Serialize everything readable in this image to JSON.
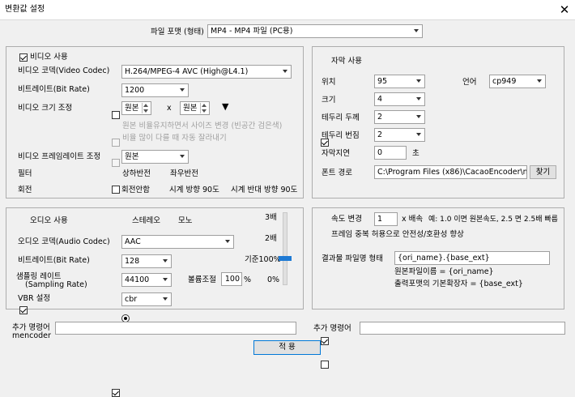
{
  "window": {
    "title": "변환값 설정",
    "close_label": "✕"
  },
  "format": {
    "label": "파일 포맷 (형태)",
    "value": "MP4 - MP4 파일 (PC용)"
  },
  "video": {
    "use_label": "비디오 사용",
    "use_checked": true,
    "codec_label": "비디오 코덱(Video Codec)",
    "codec_value": "H.264/MPEG-4 AVC (High@L4.1)",
    "bitrate_label": "비트레이트(Bit Rate)",
    "bitrate_value": "1200",
    "size_label": "비디오 크기 조정",
    "size_checked": false,
    "width_value": "원본",
    "x_label": "x",
    "height_value": "원본",
    "arrow_glyph": "▼",
    "keep_ratio_label": "원본 비율유지하면서 사이즈 변경 (빈공간 검은색)",
    "crop_label": "비율 많이 다를 때 자동 잘라내기",
    "framerate_label": "비디오 프레임레이트 조정",
    "framerate_checked": false,
    "framerate_value": "원본",
    "filter_label": "필터",
    "flip_v_label": "상하반전",
    "flip_h_label": "좌우반전",
    "rotate_label": "회전",
    "rotate_none": "회전안함",
    "rotate_cw": "시계 방향 90도",
    "rotate_ccw": "시계 반대 방향 90도"
  },
  "subtitle": {
    "use_label": "자막 사용",
    "use_checked": true,
    "position_label": "위치",
    "position_value": "95",
    "language_label": "언어",
    "language_value": "cp949",
    "size_label": "크기",
    "size_value": "4",
    "border_label": "테두리 두께",
    "border_value": "2",
    "blur_label": "테두리 번짐",
    "blur_value": "2",
    "delay_label": "자막지연",
    "delay_value": "0",
    "delay_unit": "초",
    "font_label": "폰트 경로",
    "font_value": "C:\\Program Files (x86)\\CacaoEncoder\\m",
    "browse_label": "찾기"
  },
  "audio": {
    "use_label": "오디오 사용",
    "use_checked": true,
    "stereo_label": "스테레오",
    "mono_label": "모노",
    "codec_label": "오디오 코덱(Audio Codec)",
    "codec_value": "AAC",
    "bitrate_label": "비트레이트(Bit Rate)",
    "bitrate_value": "128",
    "sampling_label_1": "샘플링 레이트",
    "sampling_label_2": "(Sampling Rate)",
    "sampling_checked": true,
    "sampling_value": "44100",
    "volume_label": "볼륨조절",
    "volume_value": "100",
    "volume_unit": "%",
    "vbr_label": "VBR 설정",
    "vbr_value": "cbr",
    "scale_3x": "3배",
    "scale_2x": "2배",
    "scale_base": "기준100%",
    "scale_0": "0%"
  },
  "speed": {
    "use_label": "속도 변경",
    "use_checked": true,
    "value": "1",
    "unit": "x 배속",
    "example": "예: 1.0 이면 원본속도, 2.5 면 2.5배 빠름",
    "dup_label": "프레임 중복 허용으로 안전성/호환성 향상",
    "dup_checked": false,
    "result_label": "결과물 파일명 형태",
    "result_value": "{ori_name}.{base_ext}",
    "hint1": "원본파일이름 = {ori_name}",
    "hint2": "출력포맷의 기본확장자 = {base_ext}"
  },
  "extra": {
    "mencoder_label_1": "추가 명령어",
    "mencoder_label_2": "mencoder",
    "mencoder_value": "",
    "cmd_label": "추가 명령어",
    "cmd_value": ""
  },
  "apply_label": "적 용"
}
